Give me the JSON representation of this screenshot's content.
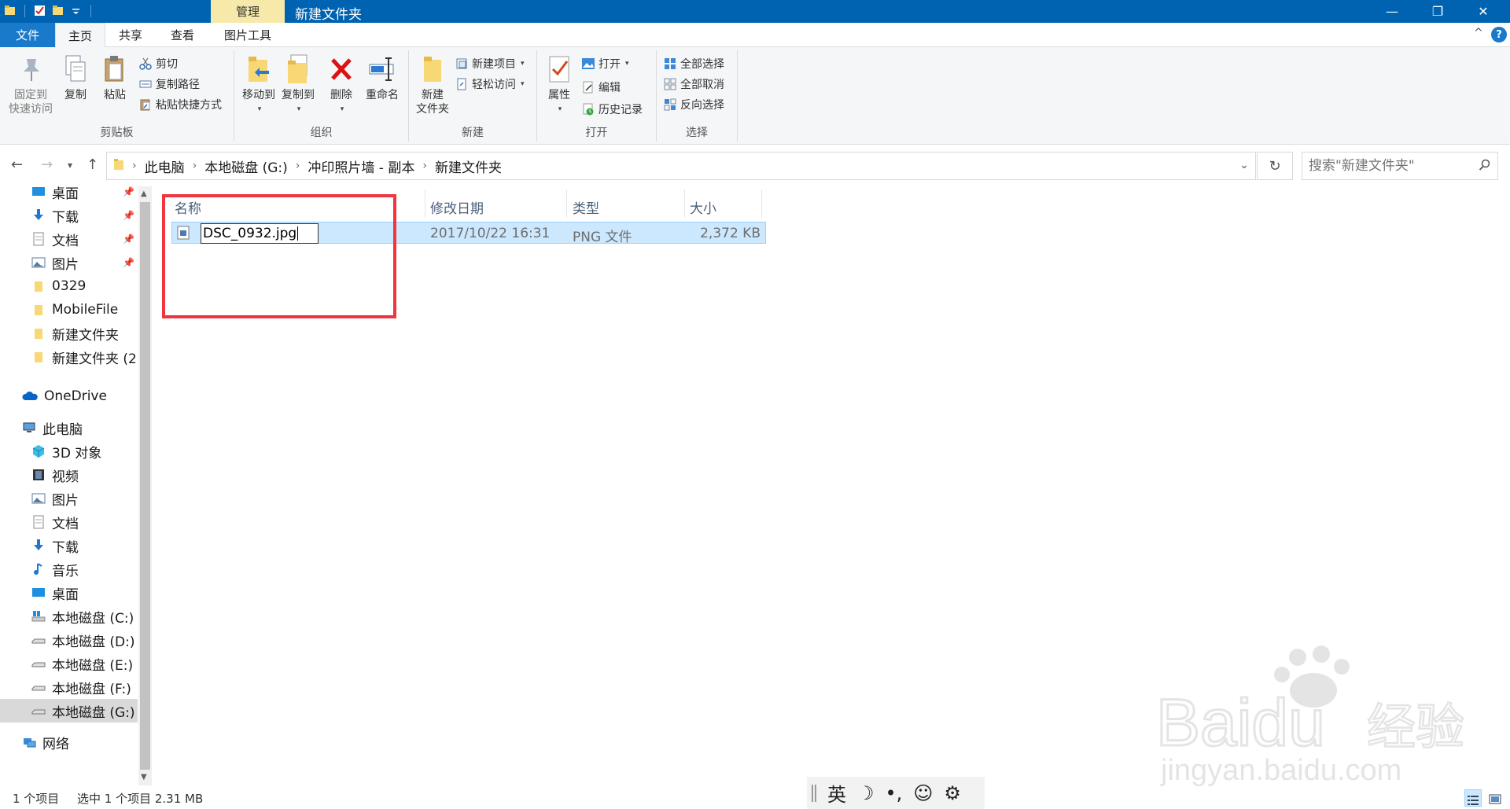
{
  "titlebar": {
    "context_tab": "管理",
    "title": "新建文件夹",
    "controls": {
      "minimize": "—",
      "maximize": "❐",
      "close": "✕"
    }
  },
  "ribbon_tabs": {
    "file": "文件",
    "home": "主页",
    "share": "共享",
    "view": "查看",
    "picture_tools": "图片工具",
    "collapse": "^",
    "help": "?"
  },
  "ribbon": {
    "clipboard": {
      "label": "剪贴板",
      "pin": "固定到\n快速访问",
      "pin_l1": "固定到",
      "pin_l2": "快速访问",
      "copy": "复制",
      "paste": "粘贴",
      "cut": "剪切",
      "copy_path": "复制路径",
      "paste_shortcut": "粘贴快捷方式"
    },
    "organize": {
      "label": "组织",
      "move_to": "移动到",
      "copy_to": "复制到",
      "delete": "删除",
      "rename": "重命名"
    },
    "new": {
      "label": "新建",
      "new_folder_l1": "新建",
      "new_folder_l2": "文件夹",
      "new_item": "新建项目",
      "easy_access": "轻松访问"
    },
    "open": {
      "label": "打开",
      "properties": "属性",
      "open": "打开",
      "edit": "编辑",
      "history": "历史记录"
    },
    "select": {
      "label": "选择",
      "select_all": "全部选择",
      "select_none": "全部取消",
      "invert": "反向选择"
    }
  },
  "address": {
    "crumbs": [
      "此电脑",
      "本地磁盘 (G:)",
      "冲印照片墙 - 副本",
      "新建文件夹"
    ],
    "search_placeholder": "搜索\"新建文件夹\""
  },
  "sidebar": {
    "quick": [
      {
        "label": "桌面",
        "pinned": true
      },
      {
        "label": "下载",
        "pinned": true
      },
      {
        "label": "文档",
        "pinned": true
      },
      {
        "label": "图片",
        "pinned": true
      },
      {
        "label": "0329"
      },
      {
        "label": "MobileFile"
      },
      {
        "label": "新建文件夹"
      },
      {
        "label": "新建文件夹 (2"
      }
    ],
    "onedrive": "OneDrive",
    "this_pc": "此电脑",
    "pc_items": [
      "3D 对象",
      "视频",
      "图片",
      "文档",
      "下载",
      "音乐",
      "桌面",
      "本地磁盘 (C:)",
      "本地磁盘 (D:)",
      "本地磁盘 (E:)",
      "本地磁盘 (F:)",
      "本地磁盘 (G:)"
    ],
    "network": "网络"
  },
  "filelist": {
    "columns": {
      "name": "名称",
      "modified": "修改日期",
      "type": "类型",
      "size": "大小"
    },
    "rows": [
      {
        "name": "DSC_0932.jpg",
        "modified": "2017/10/22 16:31",
        "type": "PNG 文件",
        "size": "2,372 KB"
      }
    ]
  },
  "status": {
    "count": "1 个项目",
    "selected": "选中 1 个项目  2.31 MB"
  },
  "ime": {
    "lang": "英",
    "moon": "☽",
    "punct": "•,",
    "emoji": "☺",
    "settings": "⚙"
  },
  "watermark": {
    "brand_en": "Bai",
    "brand_du": "du",
    "brand_cn": "经验",
    "url": "jingyan.baidu.com"
  },
  "colors": {
    "titlebar": "#0063b1",
    "file_tab": "#1979ca",
    "context_tab": "#f6e9a9",
    "selection": "#cce8ff",
    "highlight_box": "#f0353f"
  }
}
